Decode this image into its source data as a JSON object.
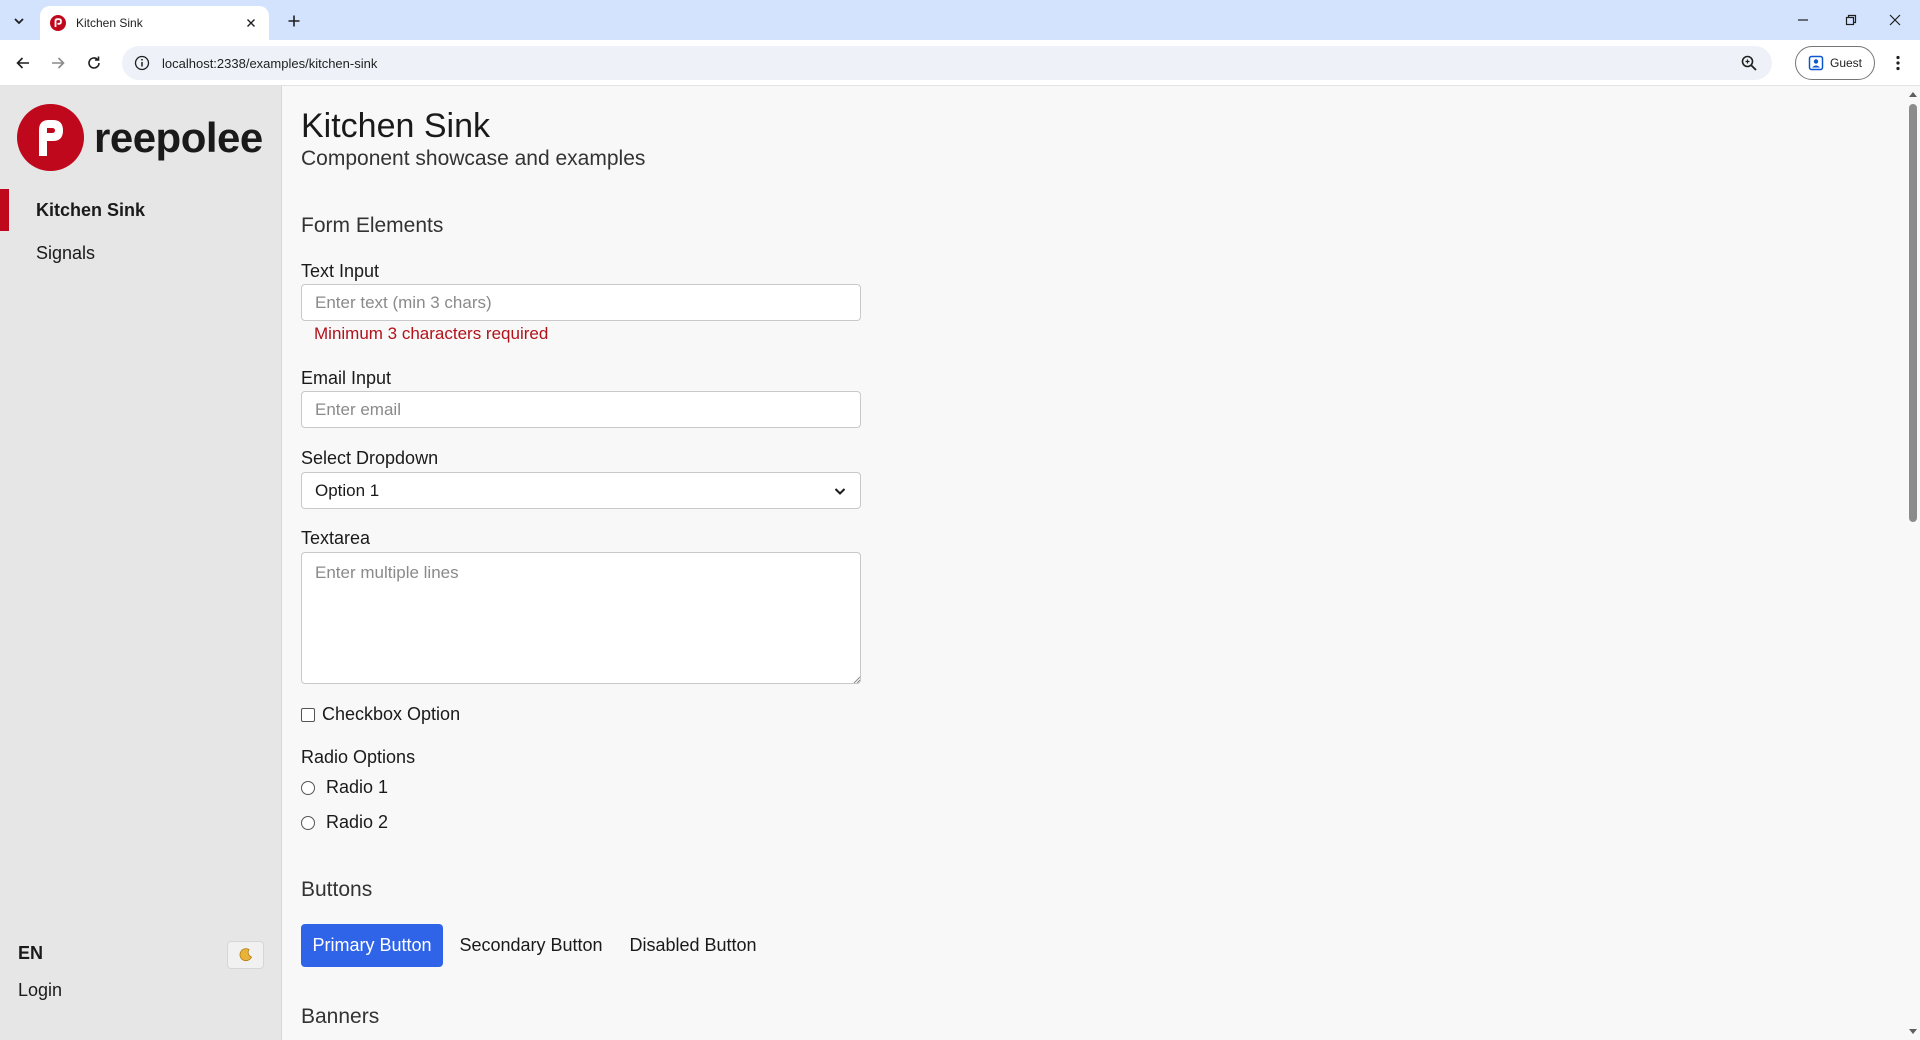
{
  "browser": {
    "tab_title": "Kitchen Sink",
    "url": "localhost:2338/examples/kitchen-sink",
    "profile_label": "Guest"
  },
  "sidebar": {
    "brand": "reepolee",
    "items": [
      {
        "label": "Kitchen Sink",
        "active": true
      },
      {
        "label": "Signals",
        "active": false
      }
    ],
    "language": "EN",
    "login": "Login"
  },
  "main": {
    "title": "Kitchen Sink",
    "subtitle": "Component showcase and examples",
    "form": {
      "section_title": "Form Elements",
      "text_input": {
        "label": "Text Input",
        "placeholder": "Enter text (min 3 chars)",
        "value": "",
        "error": "Minimum 3 characters required"
      },
      "email_input": {
        "label": "Email Input",
        "placeholder": "Enter email",
        "value": ""
      },
      "select": {
        "label": "Select Dropdown",
        "value": "Option 1"
      },
      "textarea": {
        "label": "Textarea",
        "placeholder": "Enter multiple lines"
      },
      "checkbox": {
        "label": "Checkbox Option",
        "checked": false
      },
      "radio": {
        "label": "Radio Options",
        "options": [
          "Radio 1",
          "Radio 2"
        ]
      }
    },
    "buttons": {
      "section_title": "Buttons",
      "primary": "Primary Button",
      "secondary": "Secondary Button",
      "disabled": "Disabled Button"
    },
    "banners": {
      "section_title": "Banners"
    }
  },
  "colors": {
    "brand": "#c0081d",
    "primary_button": "#2f63e8",
    "error": "#b1121a",
    "chrome_tabbar": "#d3e3fd"
  }
}
